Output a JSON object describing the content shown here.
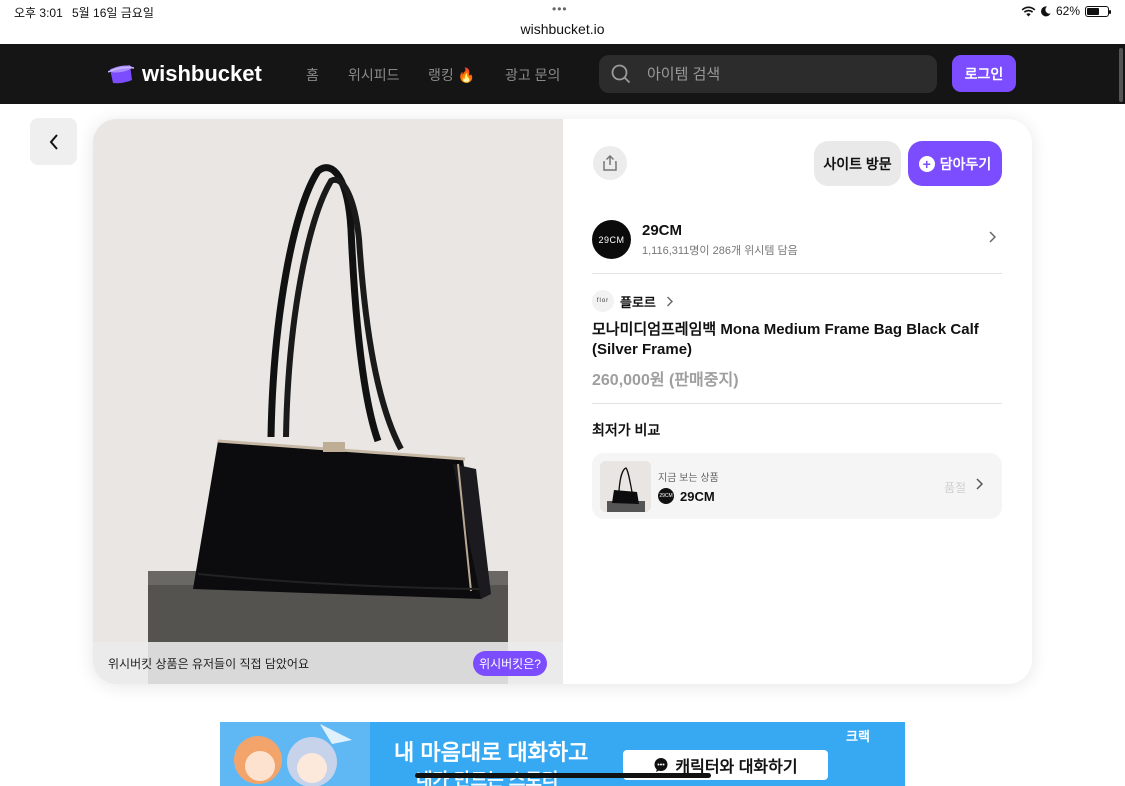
{
  "status_bar": {
    "time": "오후 3:01",
    "date": "5월 16일 금요일",
    "url": "wishbucket.io",
    "battery": "62%",
    "battery_level": 0.62,
    "dots": "•••"
  },
  "nav": {
    "logo": "wishbucket",
    "links": [
      "홈",
      "위시피드",
      "랭킹 🔥",
      "광고 문의"
    ],
    "search_placeholder": "아이템 검색",
    "login": "로그인",
    "accent": "#7b4dff"
  },
  "product": {
    "image_caption": "위시버킷 상품은 유저들이 직접 담았어요",
    "what_is_label": "위시버킷은?",
    "visit_label": "사이트 방문",
    "save_label": "담아두기",
    "store": {
      "avatar_text": "29CM",
      "name": "29CM",
      "meta": "1,116,311명이 286개 위시템 담음"
    },
    "brand": {
      "logo_text": "flor",
      "name": "플로르"
    },
    "title": "모나미디엄프레임백 Mona Medium Frame Bag Black Calf (Silver Frame)",
    "price": "260,000원 (판매중지)"
  },
  "compare": {
    "title": "최저가 비교",
    "label": "지금 보는 상품",
    "store_name": "29CM",
    "store_logo_text": "29CM",
    "status": "품절"
  },
  "ad": {
    "brand": "크랙",
    "headline": "내 마음대로 대화하고",
    "sub": "내가 만드는 스토리",
    "cta": "캐릭터와 대화하기"
  }
}
